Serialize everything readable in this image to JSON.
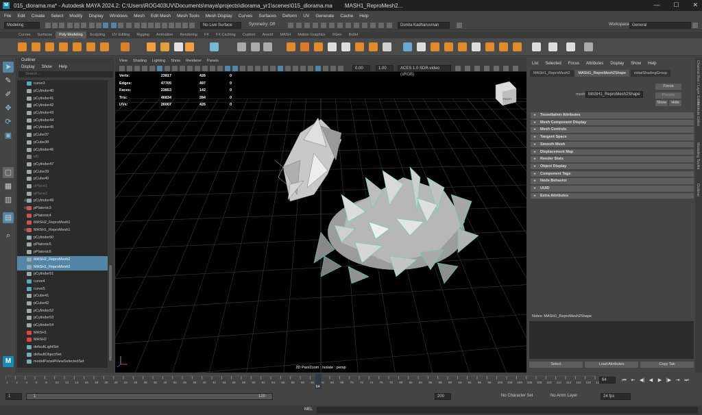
{
  "window": {
    "doc": "015_diorama.ma*",
    "title": "015_diorama.ma* - Autodesk MAYA 2024.2: C:\\Users\\ROG403UV\\Documents\\maya\\projects\\diorama_yr1\\scenes\\015_diorama.ma",
    "extra": "MASH1_ReproMesh2...",
    "min": "—",
    "max": "☐",
    "close": "✕"
  },
  "menus": [
    "File",
    "Edit",
    "Create",
    "Select",
    "Modify",
    "Display",
    "Windows",
    "Mesh",
    "Edit Mesh",
    "Mesh Tools",
    "Mesh Display",
    "Curves",
    "Surfaces",
    "Deform",
    "UV",
    "Generate",
    "Cache",
    "Help"
  ],
  "status": {
    "mode": "Modeling",
    "live": "No Live Surface",
    "symmetry": "Symmetry: Off",
    "user": "Donita Kadharusman",
    "workspace_label": "Workspace :",
    "workspace": "General"
  },
  "shelf_tabs": [
    "Curves",
    "Surfaces",
    "Poly Modeling",
    "Sculpting",
    "UV Editing",
    "Rigging",
    "Animation",
    "Rendering",
    "FX",
    "FX Caching",
    "Custom",
    "Arnold",
    "MASH",
    "Motion Graphics",
    "XGen",
    "Bullet"
  ],
  "shelf_active": "Poly Modeling",
  "outliner": {
    "title": "Outliner",
    "menu": [
      "Display",
      "Show",
      "Help"
    ],
    "search": "Search...",
    "items": [
      {
        "name": "curve3",
        "t": "curve"
      },
      {
        "name": "pCylinder40",
        "t": "mesh"
      },
      {
        "name": "pCylinder41",
        "t": "mesh"
      },
      {
        "name": "pCylinder42",
        "t": "mesh"
      },
      {
        "name": "pCylinder43",
        "t": "mesh"
      },
      {
        "name": "pCylinder44",
        "t": "mesh"
      },
      {
        "name": "pCylinder45",
        "t": "mesh"
      },
      {
        "name": "pCube37",
        "t": "mesh"
      },
      {
        "name": "pCube38",
        "t": "mesh"
      },
      {
        "name": "pCylinder46",
        "t": "mesh"
      },
      {
        "name": "id5",
        "t": "cam",
        "dim": true
      },
      {
        "name": "pCylinder47",
        "t": "mesh"
      },
      {
        "name": "pCube39",
        "t": "mesh"
      },
      {
        "name": "pCube40",
        "t": "mesh"
      },
      {
        "name": "pPlane1",
        "t": "mesh",
        "dim": true
      },
      {
        "name": "pPlane2",
        "t": "mesh",
        "dim": true
      },
      {
        "name": "pCylinder49",
        "t": "mesh",
        "exp": true
      },
      {
        "name": "pPlatonic3",
        "t": "mash",
        "exp": true
      },
      {
        "name": "pPlatonic4",
        "t": "mash"
      },
      {
        "name": "MASH2_ReproMesh1",
        "t": "mash"
      },
      {
        "name": "MASH1_ReproMesh1",
        "t": "mash",
        "exp": true
      },
      {
        "name": "pCylinder50",
        "t": "mesh"
      },
      {
        "name": "pPlatonic5",
        "t": "mesh"
      },
      {
        "name": "pPlatonic6",
        "t": "mesh"
      },
      {
        "name": "MASH2_ReproMesh2",
        "t": "mesh",
        "sel": true
      },
      {
        "name": "MASH1_ReproMesh2",
        "t": "mesh",
        "sel": true
      },
      {
        "name": "pCylinder51",
        "t": "mesh"
      },
      {
        "name": "curve4",
        "t": "curve"
      },
      {
        "name": "curve5",
        "t": "curve"
      },
      {
        "name": "pCube41",
        "t": "mesh"
      },
      {
        "name": "pCube42",
        "t": "mesh"
      },
      {
        "name": "pCylinder52",
        "t": "mesh"
      },
      {
        "name": "pCylinder53",
        "t": "mesh"
      },
      {
        "name": "pCylinder54",
        "t": "mesh"
      },
      {
        "name": "MASH1",
        "t": "mashnode"
      },
      {
        "name": "MASH2",
        "t": "mashnode"
      },
      {
        "name": "defaultLightSet",
        "t": "set"
      },
      {
        "name": "defaultObjectSet",
        "t": "set"
      },
      {
        "name": "modelPanel4ViewSelectedSet",
        "t": "set"
      }
    ]
  },
  "viewport": {
    "menu": [
      "View",
      "Shading",
      "Lighting",
      "Show",
      "Renderer",
      "Panels"
    ],
    "field1": "0.00",
    "field2": "1.00",
    "colorspace": "ACES 1.0 SDR-video (sRGB)",
    "hud": [
      {
        "label": "Verts:",
        "a": "23817",
        "b": "426",
        "c": "0"
      },
      {
        "label": "Edges:",
        "a": "47705",
        "b": "497",
        "c": "0"
      },
      {
        "label": "Faces:",
        "a": "23853",
        "b": "142",
        "c": "0"
      },
      {
        "label": "Tris:",
        "a": "46834",
        "b": "284",
        "c": "0"
      },
      {
        "label": "UVs:",
        "a": "26007",
        "b": "426",
        "c": "0"
      }
    ],
    "status": "2D Pan/Zoom : Isolate : persp",
    "cube_label": "RIGHT"
  },
  "attr": {
    "menu": [
      "List",
      "Selected",
      "Focus",
      "Attributes",
      "Display",
      "Show",
      "Help"
    ],
    "tabs": [
      "MASH1_ReproMesh2",
      "MASH1_ReproMesh2Shape",
      "initialShadingGroup"
    ],
    "field_label": "mesh:",
    "field_value": "MASH1_ReproMesh2Shape",
    "focus": "Focus",
    "presets": "Presets",
    "show": "Show",
    "hide": "Hide",
    "sections": [
      "Tessellation Attributes",
      "Mesh Component Display",
      "Mesh Controls",
      "Tangent Space",
      "Smooth Mesh",
      "Displacement Map",
      "Render Stats",
      "Object Display",
      "Component Tags",
      "Node Behavior",
      "UUID",
      "Extra Attributes"
    ],
    "notes": "Notes:  MASH1_ReproMesh2Shape",
    "buttons": [
      "Select",
      "Load Attributes",
      "Copy Tab"
    ]
  },
  "side_tabs": [
    "Channel Box / Layer Editor",
    "Attribute Editor",
    "Modeling Toolkit",
    "Outliner"
  ],
  "timeline": {
    "ticks": [
      "1",
      "2",
      "4",
      "6",
      "8",
      "10",
      "12",
      "14",
      "16",
      "18",
      "20",
      "22",
      "24",
      "26",
      "28",
      "30",
      "32",
      "34",
      "36",
      "38",
      "40",
      "42",
      "44",
      "46",
      "48",
      "50",
      "52",
      "54",
      "56",
      "58",
      "60",
      "62",
      "64",
      "66",
      "68",
      "70",
      "72",
      "74",
      "76",
      "78",
      "80",
      "82",
      "84",
      "86",
      "88",
      "90",
      "92",
      "94",
      "96",
      "98",
      "100",
      "102",
      "104",
      "106",
      "108",
      "110",
      "112",
      "114",
      "116",
      "118",
      "120"
    ],
    "current": "64",
    "current_field": "64",
    "current_frac": 0.53
  },
  "range": {
    "start": "1",
    "start2": "1",
    "end": "120",
    "end2": "200",
    "char_set": "No Character Set",
    "anim_layer": "No Anim Layer",
    "fps": "24 fps"
  },
  "cmdline": {
    "lang": "MEL"
  }
}
